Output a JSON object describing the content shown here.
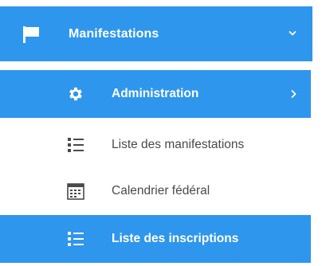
{
  "menu": {
    "header": {
      "label": "Manifestations",
      "icon": "flag-icon",
      "expand_icon": "chevron-down-icon"
    },
    "items": [
      {
        "label": "Administration",
        "icon": "gear-icon",
        "active": true,
        "has_submenu": true
      },
      {
        "label": "Liste des manifestations",
        "icon": "list-icon",
        "active": false
      },
      {
        "label": "Calendrier fédéral",
        "icon": "calendar-icon",
        "active": false
      },
      {
        "label": "Liste des inscriptions",
        "icon": "list-icon",
        "active": true
      }
    ]
  },
  "colors": {
    "accent": "#2e96ec",
    "text_inactive": "#4a4a4a",
    "text_active": "#ffffff"
  }
}
